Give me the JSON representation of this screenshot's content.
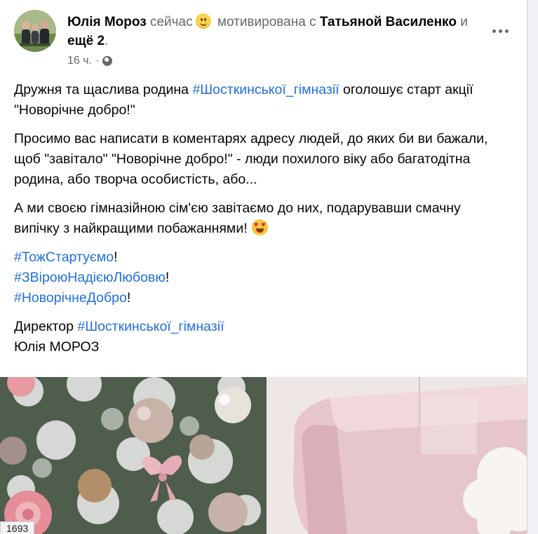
{
  "post": {
    "author": "Юлія Мороз",
    "time_word": "сейчас",
    "feeling": "мотивирована с",
    "tagged_1": "Татьяной Василенко",
    "connector": "и",
    "tagged_more": "ещё 2",
    "period": ".",
    "timestamp": "16 ч.",
    "dot": "·",
    "privacy_icon": "globe-icon",
    "feeling_icon": "smile-emoji"
  },
  "body": {
    "p1_a": "Дружня та щаслива родина ",
    "p1_tag": "#Шосткинської_гімназії",
    "p1_b": " оголошує старт акції \"Новорічне добро!\"",
    "p2": "Просимо вас написати в коментарях адресу людей, до яких би ви бажали,  щоб \"завітало\" \"Новорічне добро!\" - люди похилого віку або багатодітна родина,  або творча особистість, або...",
    "p3": "А ми своєю гімназійною  сім'єю завітаємо до них,  подарувавши смачну випічку з найкращими побажаннями!",
    "p3_emoji": "heart-eyes-emoji",
    "tag1": "#ТожСтартуємо",
    "tag2": "#ЗВіроюНадієюЛюбовю",
    "tag3": "#НоворічнеДобро",
    "excl": "!",
    "sig_a": "Директор ",
    "sig_tag": "#Шосткинської_гімназії",
    "sig_name": "Юлія МОРОЗ"
  },
  "overlay": {
    "counter": "1693"
  },
  "colors": {
    "link": "#216fdb",
    "secondary_text": "#65676b",
    "primary_text": "#050505"
  }
}
